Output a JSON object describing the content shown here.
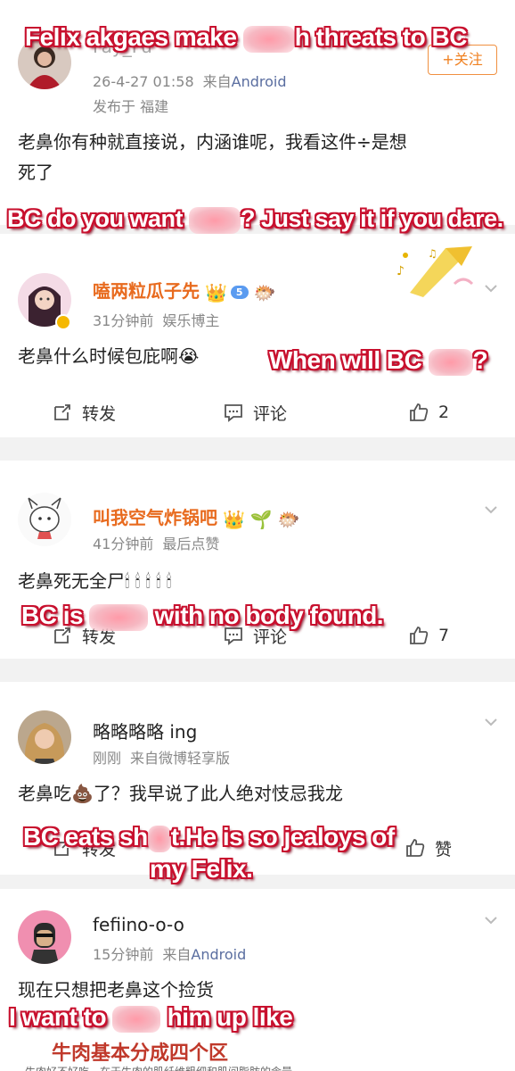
{
  "comments": [
    {
      "username": "Fay_Fu",
      "timestamp": "26-4-27 01:58",
      "source_prefix": "来自",
      "source": "Android",
      "location": "发布于 福建",
      "follow_label": "+关注",
      "text_line1": "老鼻你有种就直接说，内涵谁呢，我看这件÷是想",
      "text_line2": "死了"
    },
    {
      "username": "嗑两粒瓜子先",
      "vip_level": "5",
      "timestamp": "31分钟前",
      "role": "娱乐博主",
      "text": "老鼻什么时候包庇啊",
      "repost_label": "转发",
      "comment_label": "评论",
      "likes": "2"
    },
    {
      "username": "叫我空气炸锅吧",
      "timestamp": "41分钟前",
      "status": "最后点赞",
      "text": "老鼻死无全尸",
      "repost_label": "转发",
      "comment_label": "评论",
      "likes": "7"
    },
    {
      "username": "略略略略 ing",
      "timestamp": "刚刚",
      "source": "来自微博轻享版",
      "text_before": "老鼻吃",
      "text_after": "了？我早说了此人绝对忮忌我龙",
      "repost_label": "转发",
      "like_label": "赞"
    },
    {
      "username": "fefiino-o-o",
      "timestamp": "15分钟前",
      "source_prefix": "来自",
      "source": "Android",
      "text": "现在只想把老鼻这个捡货",
      "image_title": "牛肉基本分成四个区",
      "image_subtitle": "牛肉好不好吃，在于牛肉的肌纤维粗细和肌间脂肪的含量"
    }
  ],
  "overlays": {
    "o1_a": "Felix akgaes make",
    "o1_b": "h threats to BC",
    "o2_a": "BC do you want",
    "o2_b": "? Just say it if you dare.",
    "o3_a": "When will BC",
    "o3_b": "?",
    "o4_a": "BC is",
    "o4_b": "with no body found.",
    "o5_a": "BC eats sh",
    "o5_b": "t.He is so jealoys of",
    "o5_c": "my Felix.",
    "o6_a": "I want to",
    "o6_b": "him up like"
  },
  "colors": {
    "username_orange": "#e86b1f",
    "overlay_red": "#c8102e",
    "link_blue": "#5a6ea0"
  }
}
